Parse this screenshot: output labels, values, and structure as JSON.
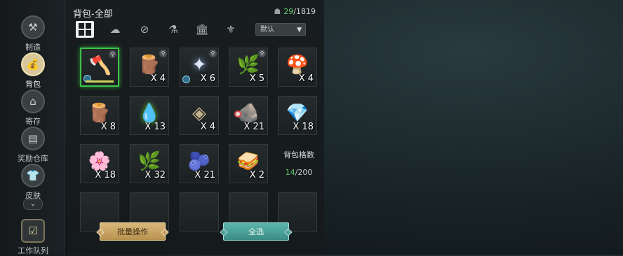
{
  "nav": {
    "items": [
      {
        "label": "制造",
        "icon": "craft-icon"
      },
      {
        "label": "背包",
        "icon": "bag-icon"
      },
      {
        "label": "寄存",
        "icon": "storage-icon"
      },
      {
        "label": "奖励仓库",
        "icon": "reward-warehouse-icon"
      },
      {
        "label": "皮肤",
        "icon": "skin-icon"
      }
    ],
    "queue_label": "工作队列"
  },
  "header": {
    "title": "背包-全部",
    "capacity_current": "29",
    "capacity_sep": "/",
    "capacity_max": "1819"
  },
  "categories": [
    "all-grid-icon",
    "materials-icon",
    "tools-icon",
    "potion-icon",
    "building-icon",
    "crafting-table-icon"
  ],
  "sort": {
    "label": "默认"
  },
  "items": [
    {
      "name": "axe-tool",
      "qty": "",
      "selected": true,
      "locked": true,
      "durability": 1.0
    },
    {
      "name": "wood-logs",
      "qty": "X 4",
      "locked": true
    },
    {
      "name": "glowing-essence",
      "qty": "X 6",
      "locked": true
    },
    {
      "name": "fiber-leaves",
      "qty": "X 5",
      "locked": true
    },
    {
      "name": "mushroom",
      "qty": "X 4"
    },
    {
      "name": "wood-logs",
      "qty": "X 8"
    },
    {
      "name": "green-essence",
      "qty": "X 13"
    },
    {
      "name": "ore-chunk",
      "qty": "X 4"
    },
    {
      "name": "stone",
      "qty": "X 21"
    },
    {
      "name": "crystal",
      "qty": "X 18"
    },
    {
      "name": "orchid-flower",
      "qty": "X 18"
    },
    {
      "name": "fiber-leaves",
      "qty": "X 32"
    },
    {
      "name": "blackberries",
      "qty": "X 21"
    },
    {
      "name": "sandwich",
      "qty": "X 2"
    }
  ],
  "bag_capacity": {
    "label": "背包格数",
    "current": "14",
    "sep": "/",
    "max": "200"
  },
  "buttons": {
    "batch": "批量操作",
    "select_all": "全选"
  },
  "colors": {
    "accent_green": "#5fc86a",
    "batch_button": "#c9a660",
    "select_button": "#4aa19a"
  }
}
